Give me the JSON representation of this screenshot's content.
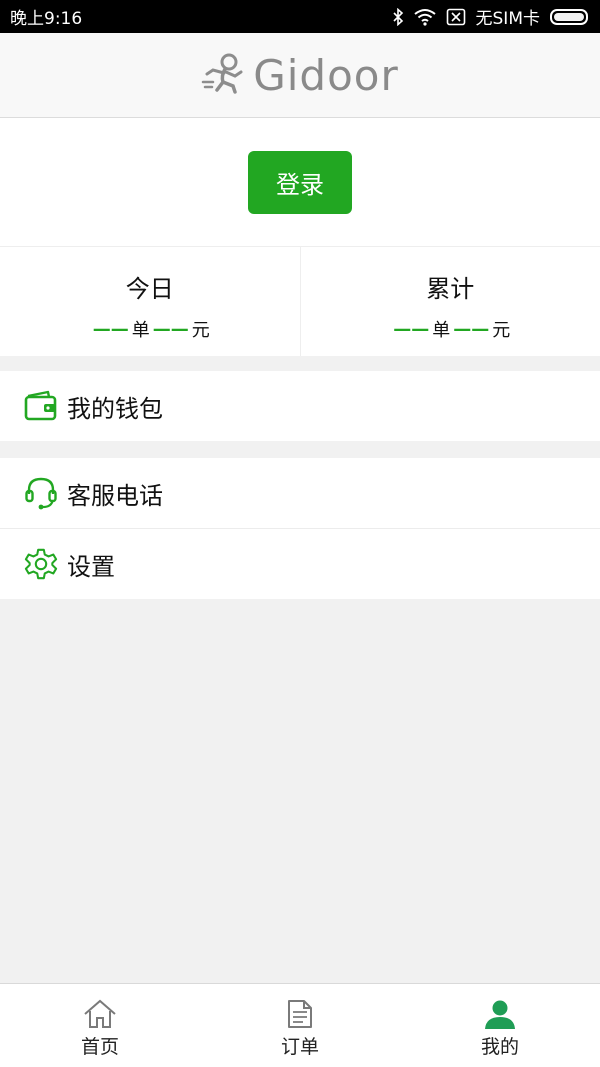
{
  "status_bar": {
    "time": "晚上9:16",
    "carrier": "无SIM卡"
  },
  "header": {
    "brand": "Gidoor"
  },
  "login": {
    "label": "登录"
  },
  "stats": {
    "today": {
      "title": "今日",
      "dashes_orders": "——",
      "unit_orders": "单",
      "dashes_amount": "——",
      "unit_amount": "元"
    },
    "total": {
      "title": "累计",
      "dashes_orders": "——",
      "unit_orders": "单",
      "dashes_amount": "——",
      "unit_amount": "元"
    }
  },
  "menu": {
    "wallet": {
      "label": "我的钱包",
      "icon": "wallet-icon"
    },
    "service": {
      "label": "客服电话",
      "icon": "headset-icon"
    },
    "settings": {
      "label": "设置",
      "icon": "gear-icon"
    }
  },
  "nav": {
    "home": {
      "label": "首页",
      "icon": "home-icon"
    },
    "orders": {
      "label": "订单",
      "icon": "document-icon"
    },
    "mine": {
      "label": "我的",
      "icon": "user-icon"
    }
  },
  "colors": {
    "accent": "#22a722",
    "nav_active": "#1f9d55"
  }
}
